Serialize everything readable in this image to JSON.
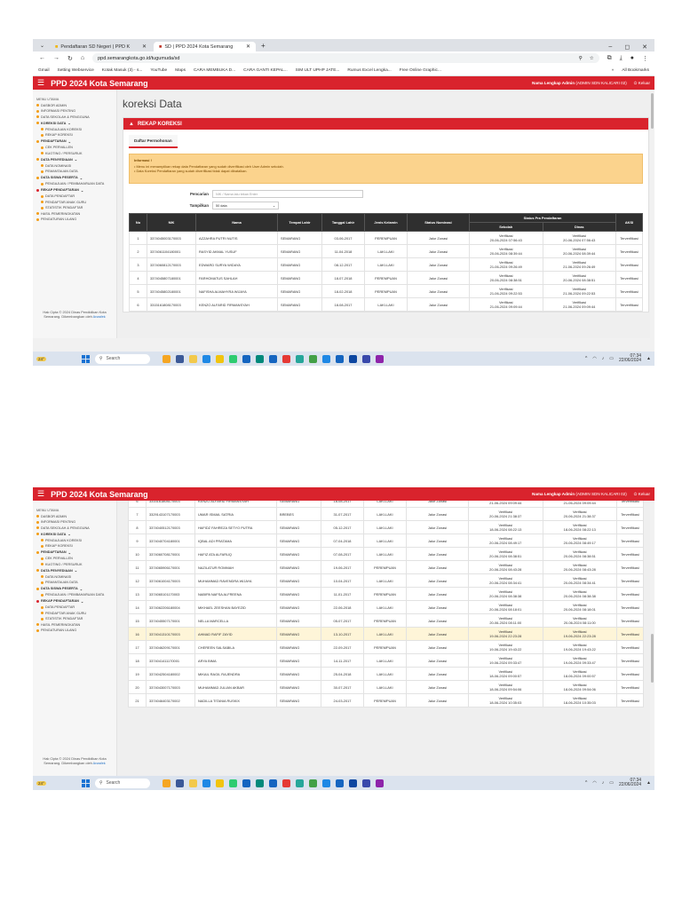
{
  "browser": {
    "tabs": [
      {
        "label": "Pendaftaran SD Negeri | PPD K"
      },
      {
        "label": "SD | PPD 2024 Kota Semarang"
      }
    ],
    "new_tab": "+",
    "url": "ppd.semarangkota.go.id/tugumuda/sd",
    "bookmarks": [
      "Gmail",
      "Setting Webservice",
      "Kotak Masuk (3) - s...",
      "YouTube",
      "Maps",
      "CARA MEMBUKA D...",
      "CARA GANTI KEPAL...",
      "SIM ULT UPHP JATE...",
      "Rumus Excel Lengka...",
      "Free Online Graphic..."
    ],
    "all_bookmarks": "All Bookmarks"
  },
  "app": {
    "title": "PPD 2024 Kota Semarang",
    "user_label": "Nama Lengkap Admin",
    "user_value": "(ADMIN SDN KALICARI 02)",
    "logout": "Keluar"
  },
  "sidebar": {
    "section": "MENU UTAMA",
    "items": [
      {
        "label": "DASBOR ADMIN",
        "type": "item",
        "color": "#f39c12"
      },
      {
        "label": "INFORMASI PENTING",
        "type": "item",
        "color": "#f39c12"
      },
      {
        "label": "DATA SEKOLAH & PENGGUNA",
        "type": "item",
        "color": "#f39c12"
      },
      {
        "label": "KOREKSI DATA",
        "type": "head",
        "color": "#f39c12"
      },
      {
        "label": "PENGAJUAN KOREKSI",
        "type": "sub",
        "color": "#f39c12"
      },
      {
        "label": "REKAP KOREKSI",
        "type": "sub",
        "color": "#f39c12"
      },
      {
        "label": "PENDAFTARAN",
        "type": "head",
        "color": "#f39c12"
      },
      {
        "label": "CEK PERVALLEN",
        "type": "sub",
        "color": "#f39c12"
      },
      {
        "label": "KUOTING / PERSURUK",
        "type": "sub",
        "color": "#f39c12"
      },
      {
        "label": "DATA PENYEDIAAN",
        "type": "head",
        "color": "#f39c12"
      },
      {
        "label": "DATA NOMINASI",
        "type": "sub",
        "color": "#f39c12"
      },
      {
        "label": "PEMANTAUAN DATA",
        "type": "sub",
        "color": "#f39c12"
      },
      {
        "label": "DATA SISWA PESERTA",
        "type": "head",
        "color": "#f39c12"
      },
      {
        "label": "PENGAJUAN / PEMBAHARUAN DATA",
        "type": "sub",
        "color": "#f39c12"
      },
      {
        "label": "REKAP PENDAFTARAN",
        "type": "head",
        "color": "#d9232d"
      },
      {
        "label": "DATA PENDAFTAR",
        "type": "sub",
        "color": "#f39c12"
      },
      {
        "label": "PENDAFTAR ANAK GURU",
        "type": "sub",
        "color": "#f39c12"
      },
      {
        "label": "STATISTIK PENDAFTAR",
        "type": "sub",
        "color": "#f39c12"
      },
      {
        "label": "HASIL PEMERINGKATAN",
        "type": "item",
        "color": "#f39c12"
      },
      {
        "label": "PENGATURAN ULANG",
        "type": "item",
        "color": "#f39c12"
      }
    ],
    "footer": "Hak Cipta © 2024 Dinas Pendidikan Kota Semarang. Dikembangkan oleh",
    "footer_link": "Anasfek"
  },
  "page": {
    "title": "koreksi Data",
    "panel_title": "REKAP KOREKSI",
    "subtab": "Daftar Permohonan",
    "info_title": "Informasi !",
    "info_lines": [
      "• Menu ini menampilkan rekap data Pendaftaran yang sudah diverifikasi oleh User Admin sekolah.",
      "• Data Koreksi Pendaftaran yang sudah diverifikasi tidak dapat dibatalkan."
    ],
    "search_label": "Pencarian",
    "search_placeholder": "NIK / Nama lalu tekan Enter",
    "show_label": "Tampilkan",
    "show_value": "50 data"
  },
  "table": {
    "headers": [
      "No",
      "NIK",
      "Nama",
      "Tempat Lahir",
      "Tanggal Lahir",
      "Jenis Kelamin",
      "Status Nominasi",
      "Status Pra Pendaftaran",
      "AKSI"
    ],
    "subheaders": [
      "Sekolah",
      "Dinas"
    ],
    "status_verified": "Verifikasi",
    "aksi": "Terverifikasi",
    "rows": [
      {
        "no": "1",
        "nik": "3374045003170003",
        "nama": "AZZAHRA PUTRI NUTIS",
        "tempat": "SEMARANG",
        "tgl": "03-06-2017",
        "jk": "PEREMPUAN",
        "status": "Jalur Zonasi",
        "t_sekolah": "20-06-2024 07:56:43",
        "t_dinas": "20-06-2024 07:56:43"
      },
      {
        "no": "2",
        "nik": "3374061104180001",
        "nama": "RASYID AKMAL YUSUF",
        "tempat": "SEMARANG",
        "tgl": "11-04-2018",
        "jk": "LAKI-LAKI",
        "status": "Jalur Zonasi",
        "t_sekolah": "20-06-2024 08:39:44",
        "t_dinas": "20-06-2024 08:39:44"
      },
      {
        "no": "3",
        "nik": "3374060812170003",
        "nama": "EDWARD SURYA WIDAYA",
        "tempat": "SEMARANG",
        "tgl": "08-12-2017",
        "jk": "LAKI-LAKI",
        "status": "Jalur Zonasi",
        "t_sekolah": "21-06-2024 09:26:49",
        "t_dinas": "21-06-2024 09:26:49"
      },
      {
        "no": "4",
        "nik": "3374045807180001",
        "nama": "FARHOMATUS SAHLAH",
        "tempat": "SEMARANG",
        "tgl": "18-07-2018",
        "jk": "PEREMPUAN",
        "status": "Jalur Zonasi",
        "t_sekolah": "20-06-2024 08:38:51",
        "t_dinas": "20-06-2024 08:38:51"
      },
      {
        "no": "5",
        "nik": "3374045802180001",
        "nama": "NAFISHA ALMAHYRA WIJAYA",
        "tempat": "SEMARANG",
        "tgl": "18-02-2018",
        "jk": "PEREMPUAN",
        "status": "Jalur Zonasi",
        "t_sekolah": "21-06-2024 09:22:53",
        "t_dinas": "21-06-2024 09:22:53"
      },
      {
        "no": "6",
        "nik": "3315161808170003",
        "nama": "KENZO ALFARID FIRMANSYAH",
        "tempat": "SEMARANG",
        "tgl": "18-08-2017",
        "jk": "LAKI-LAKI",
        "status": "Jalur Zonasi",
        "t_sekolah": "21-06-2024 09:09:44",
        "t_dinas": "21-06-2024 09:09:44"
      },
      {
        "no": "7",
        "nik": "3329143107170003",
        "nama": "UMAR ISMAIL SATRIA",
        "tempat": "BREBES",
        "tgl": "31-07-2017",
        "jk": "LAKI-LAKI",
        "status": "Jalur Zonasi",
        "t_sekolah": "20-06-2024 21:38:37",
        "t_dinas": "20-06-2024 21:38:37"
      },
      {
        "no": "8",
        "nik": "3374040512170003",
        "nama": "HAFIDZ FAHREZA SETYO PUTRA",
        "tempat": "SEMARANG",
        "tgl": "05-12-2017",
        "jk": "LAKI-LAKI",
        "status": "Jalur Zonasi",
        "t_sekolah": "18-06-2024 08:22:13",
        "t_dinas": "18-06-2024 08:22:13"
      },
      {
        "no": "9",
        "nik": "3374040704180001",
        "nama": "IQBAL ADI PRATAMA",
        "tempat": "SEMARANG",
        "tgl": "07-04-2018",
        "jk": "LAKI-LAKI",
        "status": "Jalur Zonasi",
        "t_sekolah": "20-06-2024 08:49:17",
        "t_dinas": "20-06-2024 08:49:17"
      },
      {
        "no": "10",
        "nik": "3374060708170001",
        "nama": "HAFIZ ATA ALFARUQ",
        "tempat": "SEMARANG",
        "tgl": "07-08-2017",
        "jk": "LAKI-LAKI",
        "status": "Jalur Zonasi",
        "t_sekolah": "20-06-2024 08:38:51",
        "t_dinas": "20-06-2024 08:38:51"
      },
      {
        "no": "11",
        "nik": "3374065906170001",
        "nama": "NAZILATUR ROMMAH",
        "tempat": "SEMARANG",
        "tgl": "19-06-2017",
        "jk": "PEREMPUAN",
        "status": "Jalur Zonasi",
        "t_sekolah": "20-06-2024 08:43:28",
        "t_dinas": "20-06-2024 08:43:28"
      },
      {
        "no": "12",
        "nik": "3374061004170003",
        "nama": "MUHAMMAD RAVENDRA WIJAYA",
        "tempat": "SEMARANG",
        "tgl": "10-04-2017",
        "jk": "LAKI-LAKI",
        "status": "Jalur Zonasi",
        "t_sekolah": "20-06-2024 08:34:41",
        "t_dinas": "20-06-2024 08:34:41"
      },
      {
        "no": "13",
        "nik": "3374065101170003",
        "nama": "NABIPA NAFSA ALFREENA",
        "tempat": "SEMARANG",
        "tgl": "11-01-2017",
        "jk": "PEREMPUAN",
        "status": "Jalur Zonasi",
        "t_sekolah": "20-06-2024 08:38:38",
        "t_dinas": "20-06-2024 08:38:38"
      },
      {
        "no": "14",
        "nik": "3374062206180004",
        "nama": "MIKHAEL ZEESHAN BAYEZID",
        "tempat": "SEMARANG",
        "tgl": "22-06-2018",
        "jk": "LAKI-LAKI",
        "status": "Jalur Zonasi",
        "t_sekolah": "20-06-2024 08:18:01",
        "t_dinas": "20-06-2024 08:18:01"
      },
      {
        "no": "15",
        "nik": "3374045507170001",
        "nama": "NELLA MARCELLA",
        "tempat": "SEMARANG",
        "tgl": "05-07-2017",
        "jk": "PEREMPUAN",
        "status": "Jalur Zonasi",
        "t_sekolah": "20-06-2024 08:11:00",
        "t_dinas": "20-06-2024 08:11:00"
      },
      {
        "no": "16",
        "nik": "3374041310170003",
        "nama": "AHMAD RAFIF ZAYID",
        "tempat": "SEMARANG",
        "tgl": "13-10-2017",
        "jk": "LAKI-LAKI",
        "status": "Jalur Zonasi",
        "t_sekolah": "19-06-2024 22:23:28",
        "t_dinas": "19-06-2024 22:23:28"
      },
      {
        "no": "17",
        "nik": "3374046209170001",
        "nama": "CHEREEN SALSABILA",
        "tempat": "SEMARANG",
        "tgl": "22-09-2017",
        "jk": "PEREMPUAN",
        "status": "Jalur Zonasi",
        "t_sekolah": "19-06-2024 19:43:22",
        "t_dinas": "19-06-2024 19:43:22"
      },
      {
        "no": "18",
        "nik": "3374041411170001",
        "nama": "ARYA BIMA",
        "tempat": "SEMARANG",
        "tgl": "14-11-2017",
        "jk": "LAKI-LAKI",
        "status": "Jalur Zonasi",
        "t_sekolah": "19-06-2024 09:33:47",
        "t_dinas": "19-06-2024 09:33:47"
      },
      {
        "no": "19",
        "nik": "3374042504180002",
        "nama": "MIKAIL RAGIL RAJENDRA",
        "tempat": "SEMARANG",
        "tgl": "25-04-2018",
        "jk": "LAKI-LAKI",
        "status": "Jalur Zonasi",
        "t_sekolah": "18-06-2024 09:00:57",
        "t_dinas": "18-06-2024 09:00:57"
      },
      {
        "no": "20",
        "nik": "3374043007170003",
        "nama": "MUHAMMAD JULIAN AKBAR",
        "tempat": "SEMARANG",
        "tgl": "30-07-2017",
        "jk": "LAKI-LAKI",
        "status": "Jalur Zonasi",
        "t_sekolah": "18-06-2024 09:54:06",
        "t_dinas": "18-06-2024 09:54:06"
      },
      {
        "no": "21",
        "nik": "3374046403170002",
        "nama": "NADILLA TITANIA RUSKIX",
        "tempat": "SEMARANG",
        "tgl": "24-03-2017",
        "jk": "PEREMPUAN",
        "status": "Jalur Zonasi",
        "t_sekolah": "18-06-2024 10:35:03",
        "t_dinas": "18-06-2024 10:35:03"
      }
    ]
  },
  "taskbar": {
    "search": "Search",
    "time": "07:34",
    "date": "22/06/2024",
    "weather": "24°"
  },
  "colors": {
    "brand": "#d9232d",
    "info_bg": "#fbd38d",
    "header_dark": "#2f2f2f"
  }
}
